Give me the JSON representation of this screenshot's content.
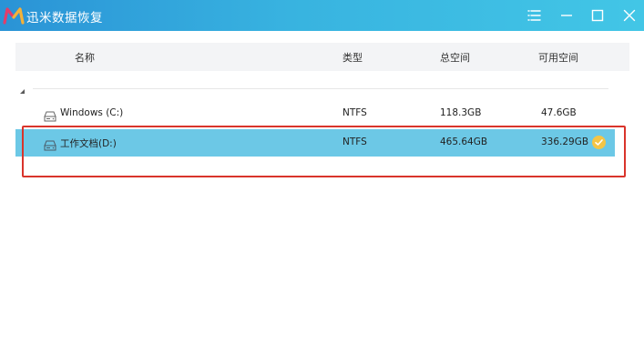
{
  "window": {
    "title": "迅米数据恢复",
    "logo_icon": "app-logo-icon",
    "controls": [
      "menu-icon",
      "minimize-icon",
      "maximize-icon",
      "close-icon"
    ],
    "accent": "#38b3e0"
  },
  "table": {
    "columns": {
      "name": "名称",
      "type": "类型",
      "total": "总空间",
      "free": "可用空间"
    },
    "rows": [
      {
        "icon": "hard-drive-icon",
        "name": "Windows (C:)",
        "type": "NTFS",
        "total": "118.3GB",
        "free": "47.6GB",
        "selected": false
      },
      {
        "icon": "hard-drive-icon",
        "name": "工作文档(D:)",
        "type": "NTFS",
        "total": "465.64GB",
        "free": "336.29GB",
        "selected": true
      }
    ]
  },
  "colors": {
    "selected_row": "#6cc8e6",
    "check_badge": "#f5c545",
    "highlight_border": "#d9342b"
  }
}
